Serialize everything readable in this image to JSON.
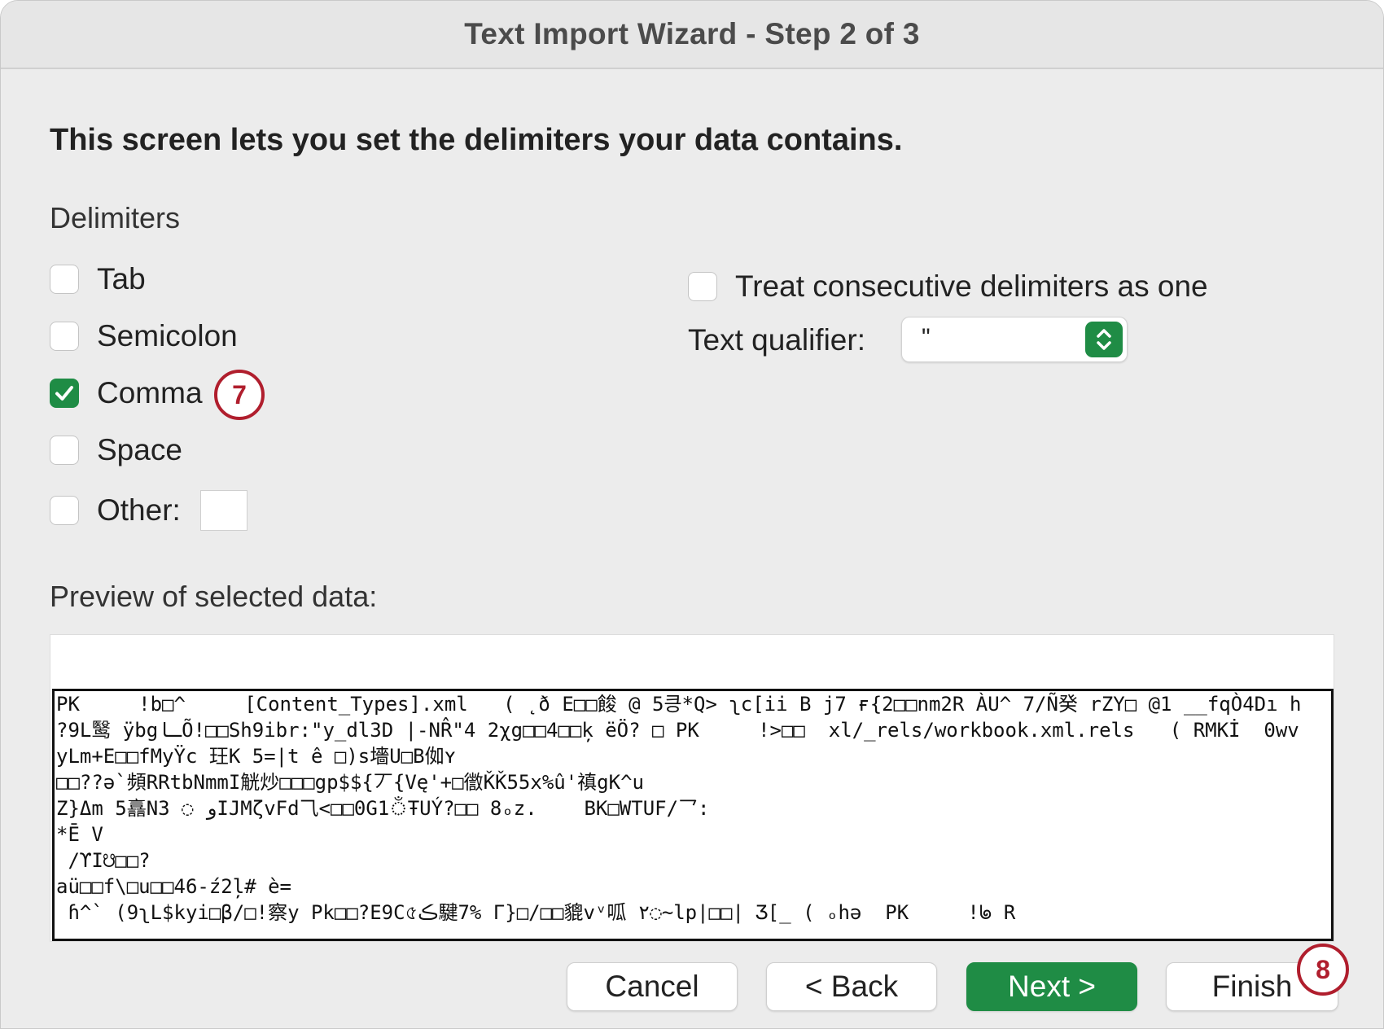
{
  "window": {
    "title": "Text Import Wizard - Step 2 of 3"
  },
  "heading": "This screen lets you set the delimiters your data contains.",
  "delimiters": {
    "label": "Delimiters",
    "items": [
      {
        "label": "Tab",
        "checked": false
      },
      {
        "label": "Semicolon",
        "checked": false
      },
      {
        "label": "Comma",
        "checked": true
      },
      {
        "label": "Space",
        "checked": false
      },
      {
        "label": "Other:",
        "checked": false
      }
    ],
    "other_value": ""
  },
  "options": {
    "consecutive_label": "Treat consecutive delimiters as one",
    "consecutive_checked": false,
    "qualifier_label": "Text qualifier:",
    "qualifier_value": "\""
  },
  "markers": {
    "comma": "7",
    "finish": "8"
  },
  "preview": {
    "label": "Preview of selected data:",
    "lines": [
      "PK     !b□^     [Content_Types].xml   ( ˛ð E□□餕 @ 5킁*Q> ʅc[ii B j7 ғ{2□□nm2R ÀU^ 7/Ñ癸 rZY□ @1 __fqÒ4Dı h",
      "?9L鹥 ÿbgـاÕ!□□Sh9ibr:\"y_dl3D |-NR̂\"4 2χg□□4□□ķ ëÖ? □ PK     !>□□  xl/_rels/workbook.xml.rels   ( RMKİ  0wv",
      "yLm+E□□fMyŸc 玨K 5=|t ê □)s墻U□B侞ʏ",
      "□□??ə`頻RRtbNmmI觥炒□□□gp$${丆{Vę'+□徾ǨǨ55x%û'禛gK^u",
      "Z}Δm 5譶N3 ◌ ﻭIJMζvFd⺄<□□0G1ঁŦUÝ?□□ 8ₒz.    BK□WTUF/乛:",
      "*Ē V",
      " /ϒI☋□□?",
      "aü□□f\\□u□□46-ź2ļ# è=",
      " ɦ^` (9ʅL$kyi□β/□!察y Pk□□?E9C৫ڪ騝7% Γ}□/□□貔vᵛ呱 ٢◌~lp|□□| Ʒ[_ ( ₒhə  PK     !ᖚ R"
    ]
  },
  "buttons": {
    "cancel": "Cancel",
    "back": "< Back",
    "next": "Next >",
    "finish": "Finish"
  },
  "colors": {
    "accent": "#1f8c45",
    "marker": "#b01e2d"
  },
  "icons": {
    "checkmark": "check-icon",
    "stepper": "chevron-updown-icon"
  }
}
